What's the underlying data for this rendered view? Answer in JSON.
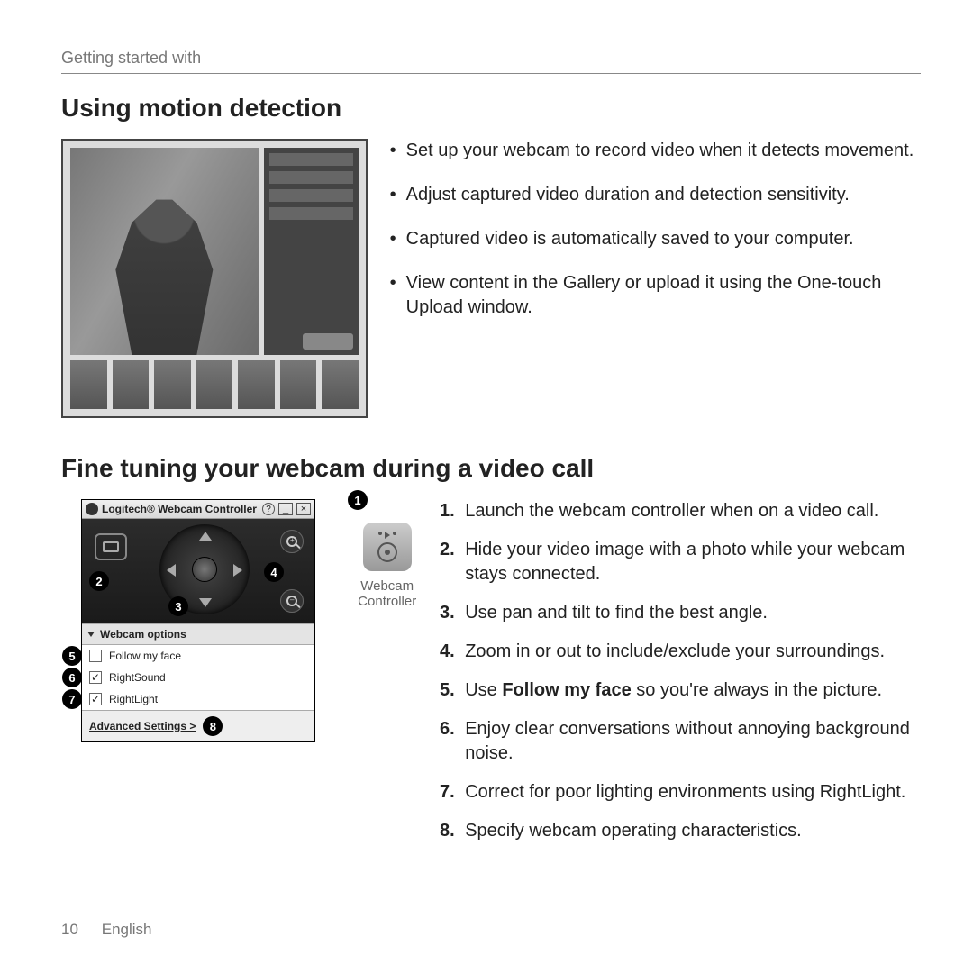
{
  "header": {
    "running": "Getting started with"
  },
  "section1": {
    "title": "Using motion detection",
    "bullets": [
      "Set up your webcam to record video when it detects movement.",
      "Adjust captured video duration and detection sensitivity.",
      "Captured video is automatically saved to your computer.",
      "View content in the Gallery or upload it using the One-touch Upload window."
    ]
  },
  "section2": {
    "title": "Fine tuning your webcam during a video call",
    "app": {
      "title": "Logitech® Webcam Controller",
      "options_header": "Webcam options",
      "options": [
        {
          "label": "Follow my face",
          "checked": false
        },
        {
          "label": "RightSound",
          "checked": true
        },
        {
          "label": "RightLight",
          "checked": true
        }
      ],
      "advanced": "Advanced Settings >"
    },
    "icon_caption": "Webcam Controller",
    "steps": [
      "Launch the webcam controller when on a video call.",
      "Hide your video image with a photo while your webcam stays connected.",
      "Use pan and tilt to find the best angle.",
      "Zoom in or out to include/exclude your surroundings.",
      "Use <b>Follow my face</b> so you're always in the picture.",
      "Enjoy clear conversations without annoying background noise.",
      "Correct for poor lighting environments using RightLight.",
      "Specify webcam operating characteristics."
    ],
    "callouts": [
      "1",
      "2",
      "3",
      "4",
      "5",
      "6",
      "7",
      "8"
    ]
  },
  "footer": {
    "page": "10",
    "language": "English"
  }
}
